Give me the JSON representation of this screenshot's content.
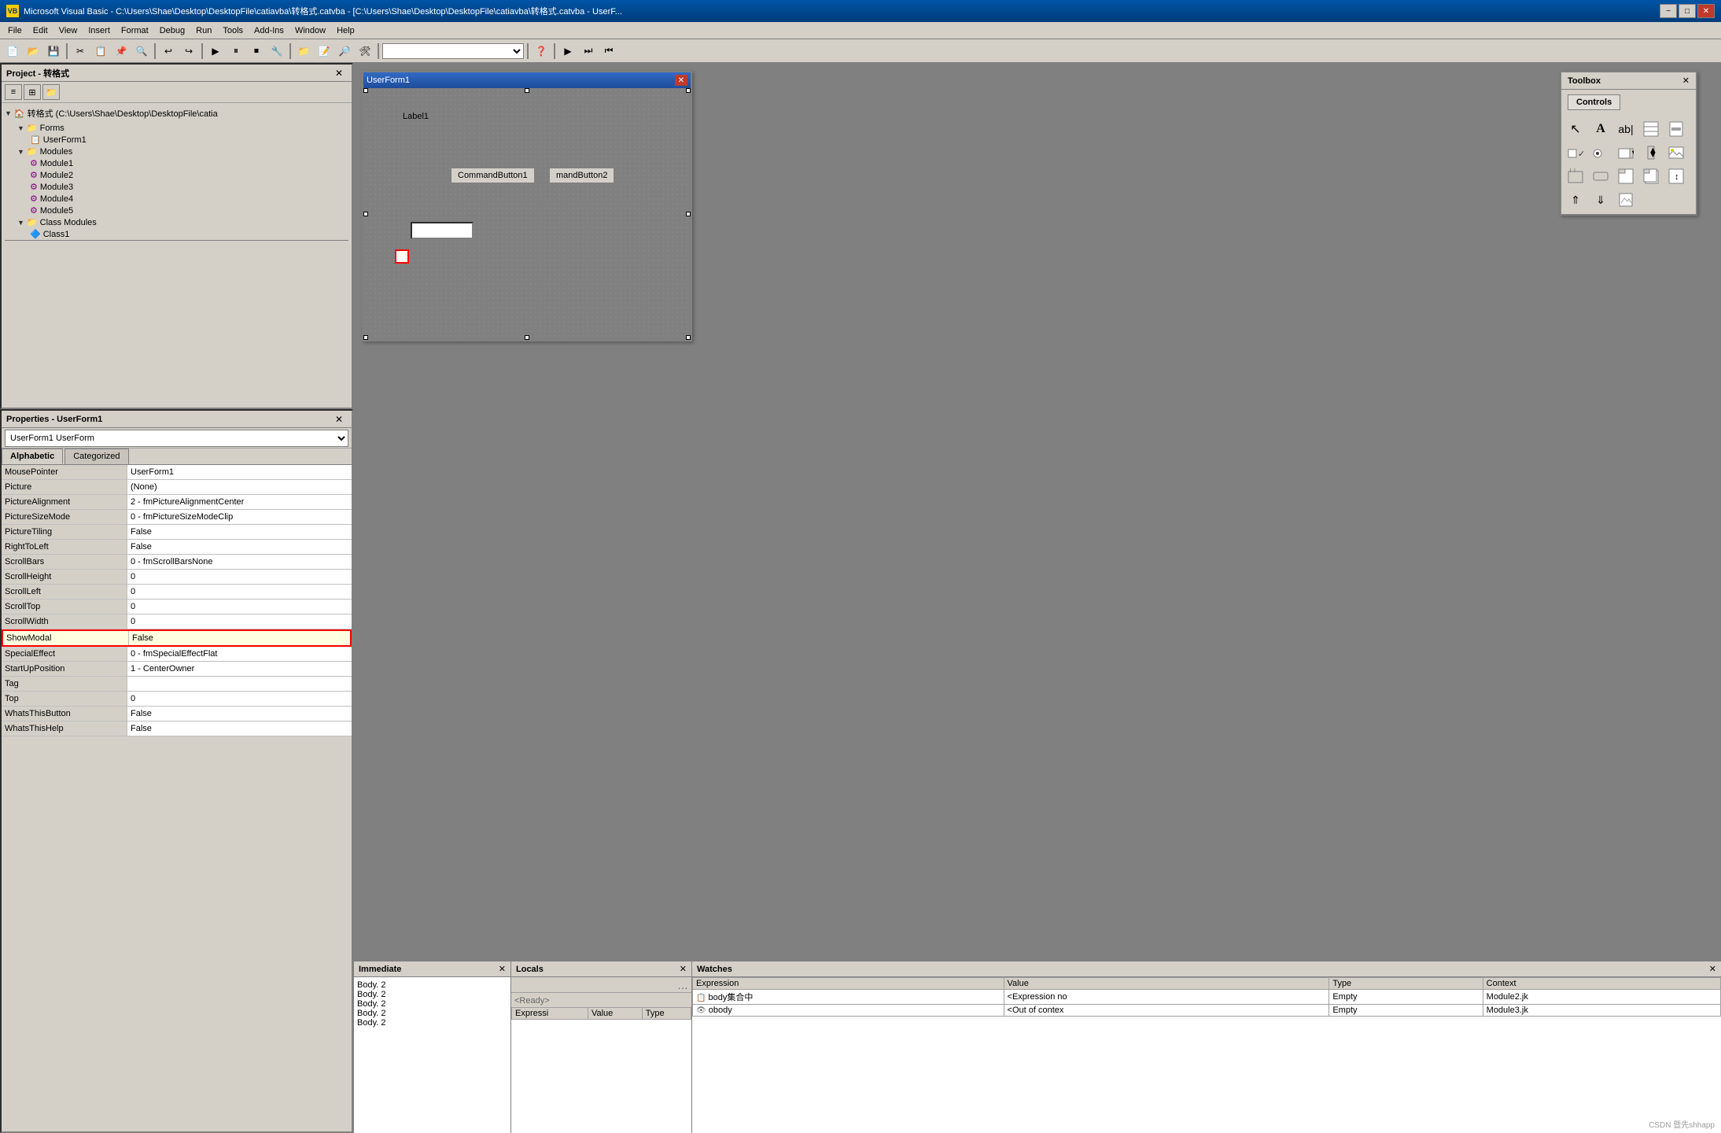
{
  "titlebar": {
    "icon": "VB",
    "text": "Microsoft Visual Basic - C:\\Users\\Shae\\Desktop\\DesktopFile\\catiavba\\转格式.catvba - [C:\\Users\\Shae\\Desktop\\DesktopFile\\catiavba\\转格式.catvba - UserF...",
    "min": "−",
    "max": "□",
    "close": "✕"
  },
  "menubar": {
    "items": [
      "File",
      "Edit",
      "View",
      "Insert",
      "Format",
      "Debug",
      "Run",
      "Tools",
      "Add-Ins",
      "Window",
      "Help"
    ]
  },
  "project_panel": {
    "title": "Project - 转格式",
    "close": "✕",
    "toolbar_buttons": [
      "□",
      "□",
      "□"
    ],
    "root": "转格式 (C:\\Users\\Shae\\Desktop\\DesktopFile\\catia",
    "forms": "Forms",
    "userform1": "UserForm1",
    "modules": "Modules",
    "module1": "Module1",
    "module2": "Module2",
    "module3": "Module3",
    "module4": "Module4",
    "module5": "Module5",
    "class_modules": "Class Modules",
    "class1": "Class1"
  },
  "properties_panel": {
    "title": "Properties - UserForm1",
    "close": "✕",
    "selector_value": "UserForm1  UserForm",
    "tab_alphabetic": "Alphabetic",
    "tab_categorized": "Categorized",
    "rows": [
      {
        "name": "MousePointer",
        "value": "UserForm1"
      },
      {
        "name": "Picture",
        "value": "(None)"
      },
      {
        "name": "PictureAlignment",
        "value": "2 - fmPictureAlignmentCenter"
      },
      {
        "name": "PictureSizeMode",
        "value": "0 - fmPictureSizeModeClip"
      },
      {
        "name": "PictureTiling",
        "value": "False"
      },
      {
        "name": "RightToLeft",
        "value": "False"
      },
      {
        "name": "ScrollBars",
        "value": "0 - fmScrollBarsNone"
      },
      {
        "name": "ScrollHeight",
        "value": "0"
      },
      {
        "name": "ScrollLeft",
        "value": "0"
      },
      {
        "name": "ScrollTop",
        "value": "0"
      },
      {
        "name": "ScrollWidth",
        "value": "0"
      },
      {
        "name": "ShowModal",
        "value": "False",
        "highlighted": true
      },
      {
        "name": "SpecialEffect",
        "value": "0 - fmSpecialEffectFlat"
      },
      {
        "name": "StartUpPosition",
        "value": "1 - CenterOwner"
      },
      {
        "name": "Tag",
        "value": ""
      },
      {
        "name": "Top",
        "value": "0"
      },
      {
        "name": "WhatsThisButton",
        "value": "False"
      },
      {
        "name": "WhatsThisHelp",
        "value": "False"
      }
    ]
  },
  "userform": {
    "title": "UserForm1",
    "label1": "Label1",
    "btn1": "CommandButton1",
    "btn2": "mandButton2"
  },
  "toolbox": {
    "title": "Toolbox",
    "close": "✕",
    "tab": "Controls",
    "tools": [
      "↖",
      "A",
      "ab|",
      "⊞",
      "⊟",
      "☑",
      "◎",
      "⊓",
      "↗",
      "⊔",
      "⊏",
      "⊢",
      "⊔",
      "⊣",
      "⊤",
      "⇑",
      "⇓",
      "🖼"
    ]
  },
  "immediate_panel": {
    "title": "Immediate",
    "close": "✕",
    "lines": [
      "Body. 2",
      "Body. 2",
      "Body. 2",
      "Body. 2",
      "Body. 2"
    ]
  },
  "locals_panel": {
    "title": "Locals",
    "close": "✕",
    "ready": "<Ready>",
    "cols": [
      "Expressi",
      "Value",
      "Type"
    ],
    "input_placeholder": ""
  },
  "watches_panel": {
    "title": "Watches",
    "close": "✕",
    "cols": [
      "Expression",
      "Value",
      "Type",
      "Context"
    ],
    "rows": [
      {
        "icon": "📋",
        "expression": "body集合中",
        "value": "<Expression no",
        "type": "Empty",
        "context": "Module2.jk"
      },
      {
        "icon": "👁",
        "expression": "obody",
        "value": "<Out of contex",
        "type": "Empty",
        "context": "Module3.jk"
      }
    ]
  },
  "watermark": "CSDN 暨先shhapp"
}
